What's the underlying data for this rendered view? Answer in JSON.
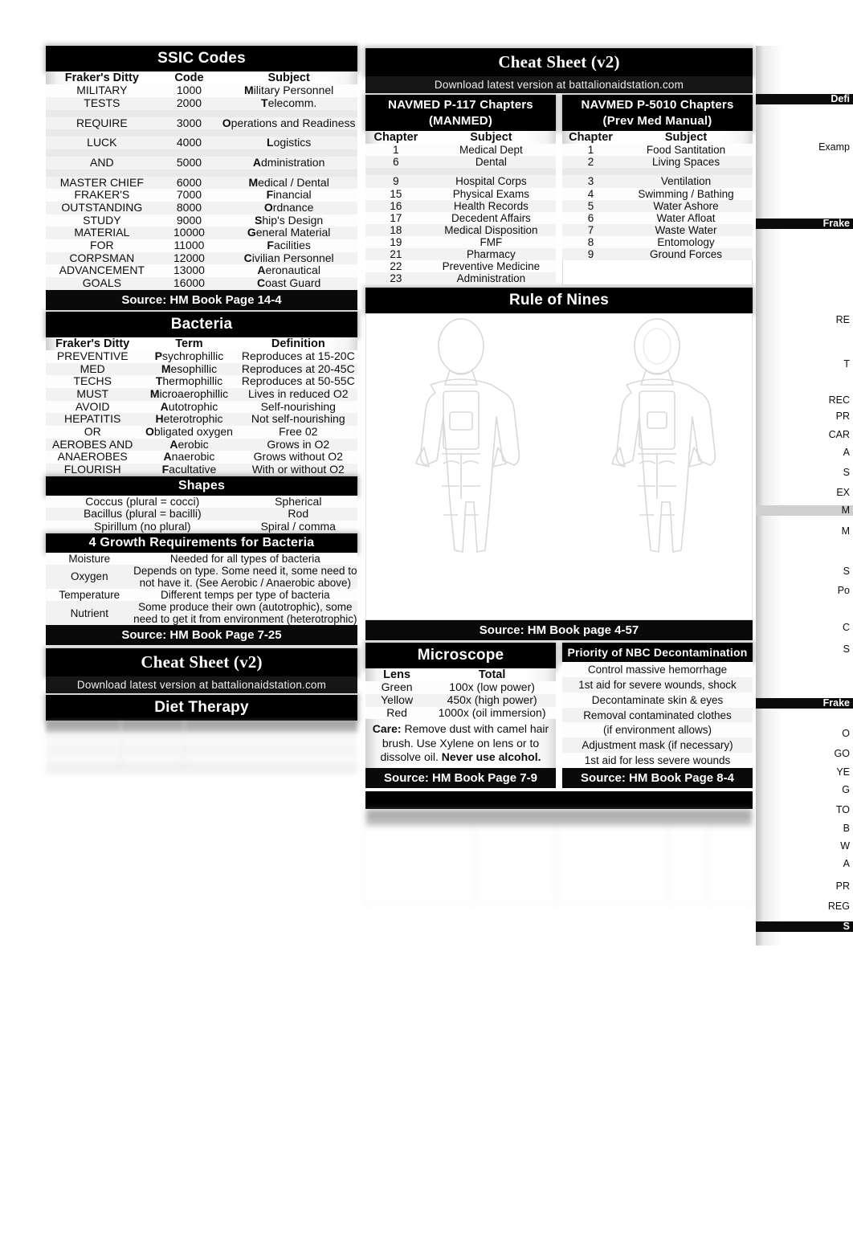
{
  "document": {
    "title": "Cheat Sheet  (v2)",
    "subtitle": "Download latest version at battalionaidstation.com"
  },
  "ssic": {
    "title": "SSIC Codes",
    "headers": [
      "Fraker's Ditty",
      "Code",
      "Subject"
    ],
    "rows": [
      [
        "MILITARY",
        "1000",
        "Military Personnel"
      ],
      [
        "TESTS",
        "2000",
        "Telecomm."
      ],
      [
        "",
        "",
        ""
      ],
      [
        "REQUIRE",
        "3000",
        "Operations and Readiness"
      ],
      [
        "",
        "",
        ""
      ],
      [
        "LUCK",
        "4000",
        "Logistics"
      ],
      [
        "",
        "",
        ""
      ],
      [
        "AND",
        "5000",
        "Administration"
      ],
      [
        "",
        "",
        ""
      ],
      [
        "MASTER CHIEF",
        "6000",
        "Medical / Dental"
      ],
      [
        "FRAKER'S",
        "7000",
        "Financial"
      ],
      [
        "OUTSTANDING",
        "8000",
        "Ordnance"
      ],
      [
        "STUDY",
        "9000",
        "Ship's Design"
      ],
      [
        "MATERIAL",
        "10000",
        "General Material"
      ],
      [
        "FOR",
        "11000",
        "Facilities"
      ],
      [
        "CORPSMAN",
        "12000",
        "Civilian Personnel"
      ],
      [
        "ADVANCEMENT",
        "13000",
        "Aeronautical"
      ],
      [
        "GOALS",
        "16000",
        "Coast Guard"
      ]
    ],
    "source": "Source: HM Book Page 14-4"
  },
  "bacteria": {
    "title": "Bacteria",
    "headers": [
      "Fraker's Ditty",
      "Term",
      "Definition"
    ],
    "rows": [
      [
        "PREVENTIVE",
        "Psychrophillic",
        "Reproduces at 15-20C"
      ],
      [
        "MED",
        "Mesophillic",
        "Reproduces at 20-45C"
      ],
      [
        "TECHS",
        "Thermophillic",
        "Reproduces at 50-55C"
      ],
      [
        "MUST",
        "Microaerophillic",
        "Lives in reduced O2"
      ],
      [
        "AVOID",
        "Autotrophic",
        "Self-nourishing"
      ],
      [
        "HEPATITIS",
        "Heterotrophic",
        "Not self-nourishing"
      ],
      [
        "OR",
        "Obligated oxygen",
        "Free 02"
      ],
      [
        "AEROBES AND",
        "Aerobic",
        "Grows in O2"
      ],
      [
        "ANAEROBES",
        "Anaerobic",
        "Grows without O2"
      ],
      [
        "FLOURISH",
        "Facultative",
        "With or without O2"
      ]
    ],
    "shapes_title": "Shapes",
    "shapes": [
      [
        "Coccus (plural = cocci)",
        "Spherical"
      ],
      [
        "Bacillus (plural = bacilli)",
        "Rod"
      ],
      [
        "Spirillum (no plural)",
        "Spiral / comma"
      ]
    ],
    "growth_title": "4 Growth Requirements for Bacteria",
    "growth": [
      [
        "Moisture",
        "Needed for all types of bacteria"
      ],
      [
        "Oxygen",
        "Depends on type. Some need it, some need to not have it. (See Aerobic / Anaerobic above)"
      ],
      [
        "Temperature",
        "Different temps per type of bacteria"
      ],
      [
        "Nutrient",
        "Some produce their own (autotrophic), some need to get it from environment (heterotrophic)"
      ]
    ],
    "source": "Source: HM Book Page 7-25"
  },
  "diet": {
    "title": "Diet Therapy"
  },
  "navmed_p117": {
    "title_line1": "NAVMED P-117 Chapters",
    "title_line2": "(MANMED)",
    "headers": [
      "Chapter",
      "Subject"
    ],
    "rows": [
      [
        "1",
        "Medical Dept"
      ],
      [
        "6",
        "Dental"
      ],
      [
        "",
        ""
      ],
      [
        "9",
        "Hospital Corps"
      ],
      [
        "15",
        "Physical Exams"
      ],
      [
        "16",
        "Health Records"
      ],
      [
        "17",
        "Decedent Affairs"
      ],
      [
        "18",
        "Medical Disposition"
      ],
      [
        "19",
        "FMF"
      ],
      [
        "21",
        "Pharmacy"
      ],
      [
        "22",
        "Preventive Medicine"
      ],
      [
        "23",
        "Administration"
      ]
    ]
  },
  "navmed_p5010": {
    "title_line1": "NAVMED P-5010 Chapters",
    "title_line2": "(Prev Med Manual)",
    "headers": [
      "Chapter",
      "Subject"
    ],
    "rows": [
      [
        "1",
        "Food Santitation"
      ],
      [
        "2",
        "Living Spaces"
      ],
      [
        "",
        ""
      ],
      [
        "3",
        "Ventilation"
      ],
      [
        "4",
        "Swimming / Bathing"
      ],
      [
        "5",
        "Water Ashore"
      ],
      [
        "6",
        "Water Afloat"
      ],
      [
        "7",
        "Waste Water"
      ],
      [
        "8",
        "Entomology"
      ],
      [
        "9",
        "Ground Forces"
      ]
    ]
  },
  "rule_of_nines": {
    "title": "Rule of Nines",
    "source": "Source: HM Book page 4-57"
  },
  "microscope": {
    "title": "Microscope",
    "headers": [
      "Lens",
      "Total"
    ],
    "rows": [
      [
        "Green",
        "100x (low power)"
      ],
      [
        "Yellow",
        "450x (high power)"
      ],
      [
        "Red",
        "1000x   (oil immersion)"
      ]
    ],
    "care_label": "Care:",
    "care_text": " Remove dust with camel hair brush. Use Xylene on lens or to dissolve oil. ",
    "care_bold_tail": "Never use alcohol.",
    "source": "Source: HM Book Page 7-9"
  },
  "nbc": {
    "title": "Priority of NBC Decontamination",
    "rows": [
      "Control massive hemorrhage",
      "1st aid for severe wounds, shock",
      "Decontaminate skin & eyes",
      "Removal contaminated clothes",
      "(if environment allows)",
      "Adjustment mask (if necessary)",
      "1st aid for less severe wounds"
    ],
    "source": "Source: HM Book Page 8-4"
  },
  "clipped_right_column": {
    "fragments": [
      "Defi",
      "Examp",
      "Frake",
      "RE",
      "T",
      "REC",
      "PR",
      "CAR",
      "A",
      "S",
      "EX",
      "M",
      "M",
      "S",
      "Po",
      "C",
      "S",
      "Frake",
      "O",
      "GO",
      "YE",
      "G",
      "TO",
      "B",
      "W",
      "A",
      "PR",
      "REG",
      "S"
    ]
  },
  "colors": {
    "band": "#000000",
    "band_sub": "#171717",
    "page_bg": "#ffffff",
    "row_light": "#f2f2f2",
    "text": "#0d0d0d"
  }
}
